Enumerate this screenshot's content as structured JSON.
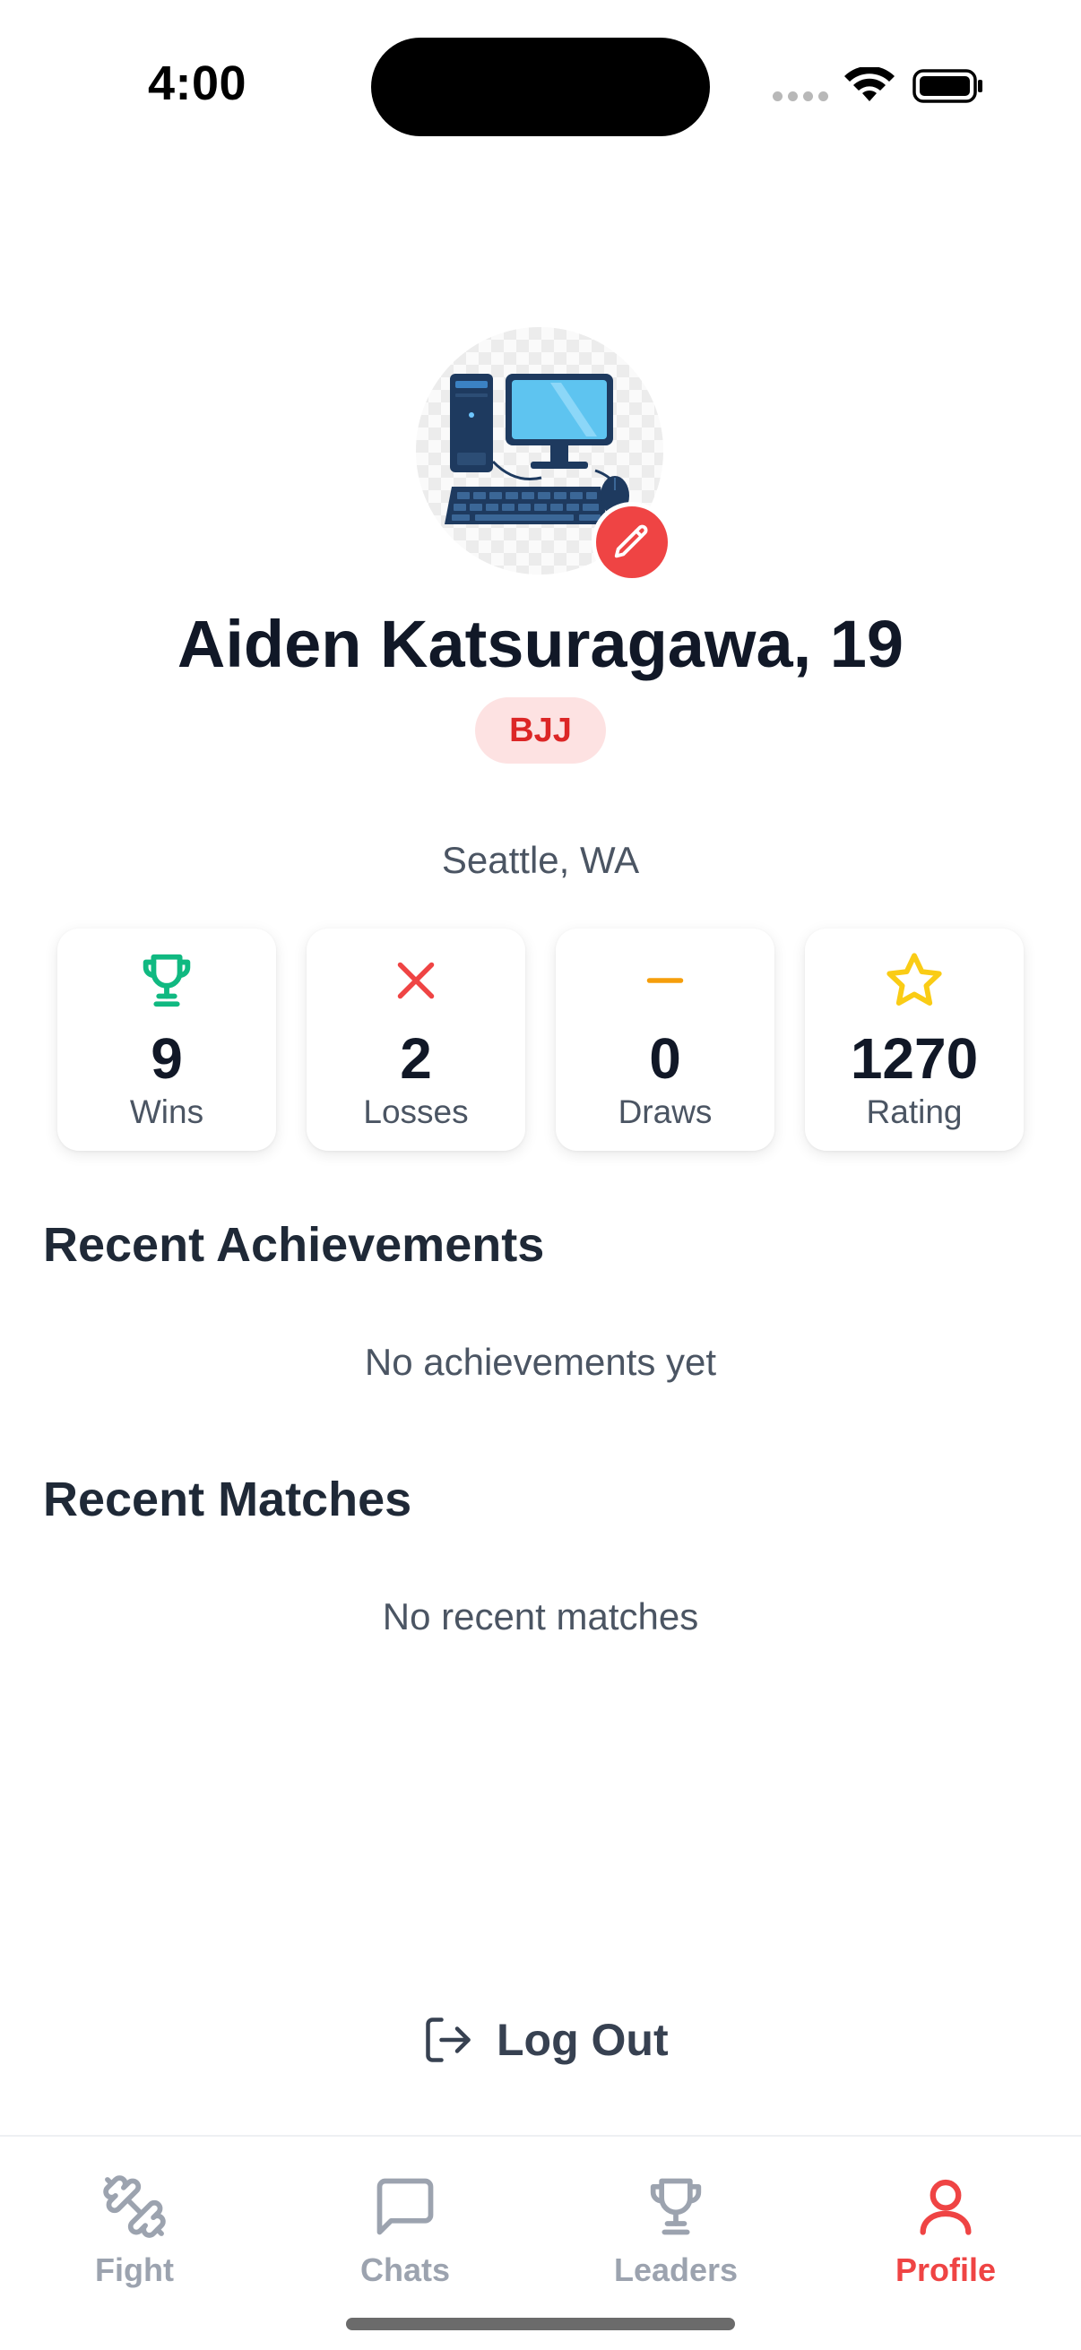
{
  "status_bar": {
    "time": "4:00"
  },
  "profile": {
    "name_line": "Aiden Katsuragawa, 19",
    "sport": "BJJ",
    "location": "Seattle, WA"
  },
  "stats": [
    {
      "value": "9",
      "label": "Wins",
      "icon": "trophy-icon",
      "color": "#10b981"
    },
    {
      "value": "2",
      "label": "Losses",
      "icon": "x-icon",
      "color": "#ef4444"
    },
    {
      "value": "0",
      "label": "Draws",
      "icon": "minus-icon",
      "color": "#f59e0b"
    },
    {
      "value": "1270",
      "label": "Rating",
      "icon": "star-icon",
      "color": "#facc15"
    }
  ],
  "achievements": {
    "title": "Recent Achievements",
    "empty": "No achievements yet"
  },
  "matches": {
    "title": "Recent Matches",
    "empty": "No recent matches"
  },
  "logout_label": "Log Out",
  "tabs": [
    {
      "label": "Fight",
      "icon": "dumbbell-icon",
      "active": false
    },
    {
      "label": "Chats",
      "icon": "chat-bubble-icon",
      "active": false
    },
    {
      "label": "Leaders",
      "icon": "trophy-icon",
      "active": false
    },
    {
      "label": "Profile",
      "icon": "user-icon",
      "active": true
    }
  ],
  "colors": {
    "accent": "#ef4444",
    "badge_bg": "#fde2e2",
    "inactive_tab": "#9ca3af"
  }
}
